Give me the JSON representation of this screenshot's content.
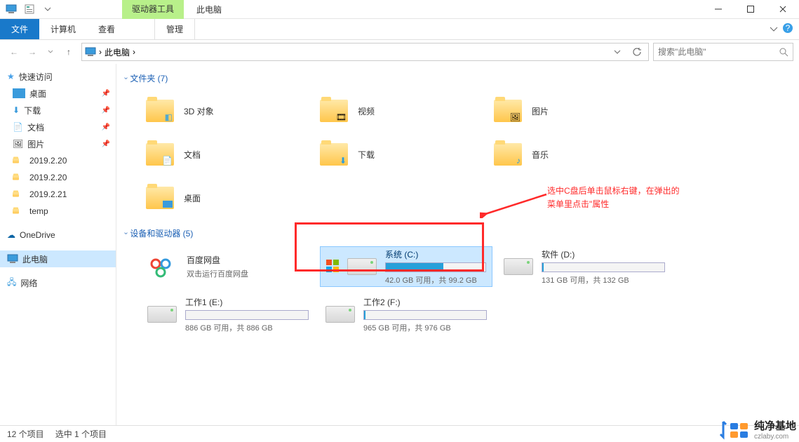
{
  "titlebar": {
    "contextual_tab_top": "驱动器工具",
    "contextual_tab_bottom": "管理",
    "title": "此电脑"
  },
  "ribbon": {
    "file": "文件",
    "computer": "计算机",
    "view": "查看"
  },
  "addressbar": {
    "location": "此电脑",
    "separator": "›"
  },
  "search": {
    "placeholder": "搜索\"此电脑\""
  },
  "sidebar": {
    "quick_access": "快速访问",
    "desktop": "桌面",
    "downloads": "下载",
    "documents": "文档",
    "pictures": "图片",
    "f1": "2019.2.20",
    "f2": "2019.2.20",
    "f3": "2019.2.21",
    "f4": "temp",
    "onedrive": "OneDrive",
    "this_pc": "此电脑",
    "network": "网络"
  },
  "groups": {
    "folders": "文件夹 (7)",
    "devices": "设备和驱动器 (5)"
  },
  "folders": {
    "objects3d": "3D 对象",
    "videos": "视频",
    "pictures": "图片",
    "documents": "文档",
    "downloads": "下载",
    "music": "音乐",
    "desktop": "桌面"
  },
  "drives": {
    "baidu": {
      "name": "百度网盘",
      "sub": "双击运行百度网盘"
    },
    "c": {
      "name": "系统 (C:)",
      "sub": "42.0 GB 可用，共 99.2 GB",
      "fill_pct": 58
    },
    "d": {
      "name": "软件 (D:)",
      "sub": "131 GB 可用，共 132 GB",
      "fill_pct": 1
    },
    "e": {
      "name": "工作1 (E:)",
      "sub": "886 GB 可用，共 886 GB",
      "fill_pct": 0
    },
    "f": {
      "name": "工作2 (F:)",
      "sub": "965 GB 可用，共 976 GB",
      "fill_pct": 1
    }
  },
  "statusbar": {
    "items": "12 个项目",
    "selected": "选中 1 个项目"
  },
  "annotation": {
    "line1": "选中C盘后单击鼠标右键，在弹出的",
    "line2": "菜单里点击\"属性"
  },
  "watermark": {
    "title": "纯净基地",
    "url": "czlaby.com"
  }
}
